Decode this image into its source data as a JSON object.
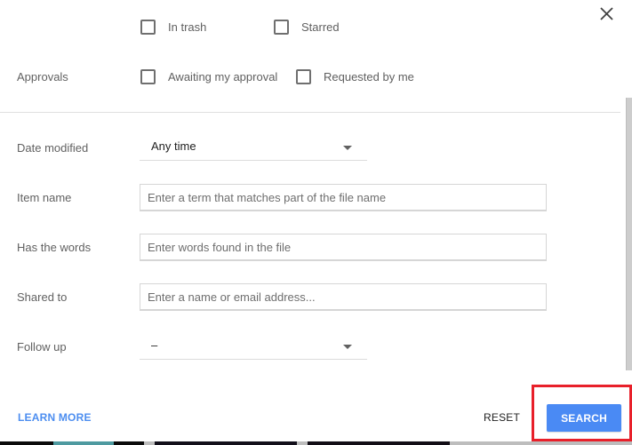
{
  "dialog": {
    "close_icon": "close-icon",
    "checkbox_row_1": [
      {
        "label": "In trash",
        "checked": false
      },
      {
        "label": "Starred",
        "checked": false
      }
    ],
    "approvals": {
      "label": "Approvals",
      "options": [
        {
          "label": "Awaiting my approval",
          "checked": false
        },
        {
          "label": "Requested by me",
          "checked": false
        }
      ]
    },
    "date_modified": {
      "label": "Date modified",
      "value": "Any time"
    },
    "item_name": {
      "label": "Item name",
      "value": "",
      "placeholder": "Enter a term that matches part of the file name"
    },
    "has_the_words": {
      "label": "Has the words",
      "value": "",
      "placeholder": "Enter words found in the file"
    },
    "shared_to": {
      "label": "Shared to",
      "value": "",
      "placeholder": "Enter a name or email address..."
    },
    "follow_up": {
      "label": "Follow up",
      "value": "–"
    },
    "footer": {
      "learn_more": "LEARN MORE",
      "reset": "RESET",
      "search": "SEARCH"
    }
  },
  "colors": {
    "accent": "#4a8af4",
    "link": "#4d8ef0",
    "highlight": "#e8202a"
  }
}
